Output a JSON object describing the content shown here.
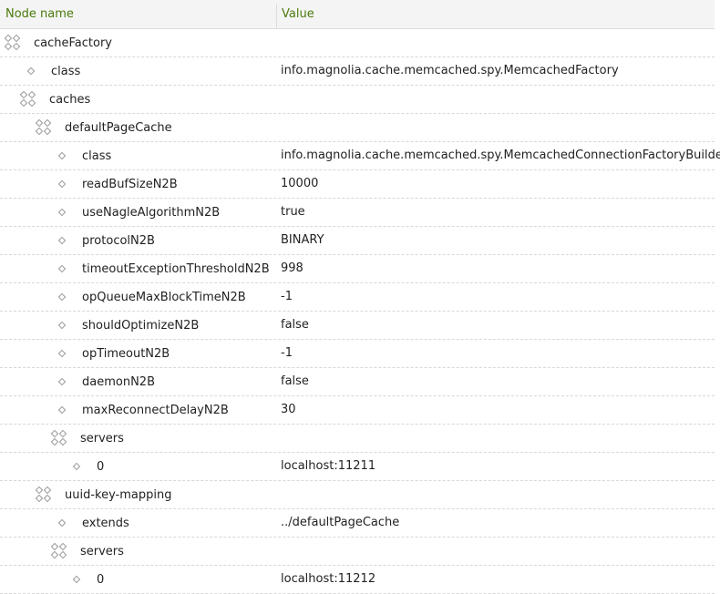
{
  "columns": {
    "name": "Node name",
    "value": "Value"
  },
  "rows": [
    {
      "name": "cacheFactory",
      "value": "",
      "type": "folder",
      "depth": 0
    },
    {
      "name": "class",
      "value": "info.magnolia.cache.memcached.spy.MemcachedFactory",
      "type": "prop",
      "depth": 1
    },
    {
      "name": "caches",
      "value": "",
      "type": "folder",
      "depth": 1
    },
    {
      "name": "defaultPageCache",
      "value": "",
      "type": "folder",
      "depth": 2
    },
    {
      "name": "class",
      "value": "info.magnolia.cache.memcached.spy.MemcachedConnectionFactoryBuilder",
      "type": "prop",
      "depth": 3
    },
    {
      "name": "readBufSizeN2B",
      "value": "10000",
      "type": "prop",
      "depth": 3
    },
    {
      "name": "useNagleAlgorithmN2B",
      "value": "true",
      "type": "prop",
      "depth": 3
    },
    {
      "name": "protocolN2B",
      "value": "BINARY",
      "type": "prop",
      "depth": 3
    },
    {
      "name": "timeoutExceptionThresholdN2B",
      "value": "998",
      "type": "prop",
      "depth": 3
    },
    {
      "name": "opQueueMaxBlockTimeN2B",
      "value": "-1",
      "type": "prop",
      "depth": 3
    },
    {
      "name": "shouldOptimizeN2B",
      "value": "false",
      "type": "prop",
      "depth": 3
    },
    {
      "name": "opTimeoutN2B",
      "value": "-1",
      "type": "prop",
      "depth": 3
    },
    {
      "name": "daemonN2B",
      "value": "false",
      "type": "prop",
      "depth": 3
    },
    {
      "name": "maxReconnectDelayN2B",
      "value": "30",
      "type": "prop",
      "depth": 3
    },
    {
      "name": "servers",
      "value": "",
      "type": "folder",
      "depth": 3
    },
    {
      "name": "0",
      "value": "localhost:11211",
      "type": "prop",
      "depth": 4
    },
    {
      "name": "uuid-key-mapping",
      "value": "",
      "type": "folder",
      "depth": 2
    },
    {
      "name": "extends",
      "value": "../defaultPageCache",
      "type": "prop",
      "depth": 3
    },
    {
      "name": "servers",
      "value": "",
      "type": "folder",
      "depth": 3
    },
    {
      "name": "0",
      "value": "localhost:11212",
      "type": "prop",
      "depth": 4
    }
  ]
}
